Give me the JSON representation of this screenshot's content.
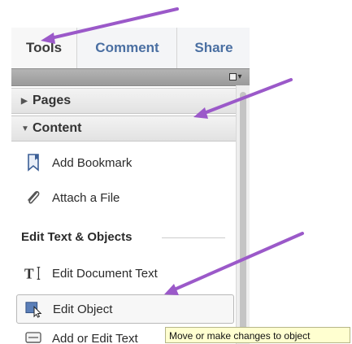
{
  "tabs": [
    {
      "label": "Tools"
    },
    {
      "label": "Comment"
    },
    {
      "label": "Share"
    }
  ],
  "sections": [
    {
      "label": "Pages",
      "state": "collapsed"
    },
    {
      "label": "Content",
      "state": "expanded"
    }
  ],
  "content_items": [
    {
      "label": "Add Bookmark",
      "icon": "bookmark-icon"
    },
    {
      "label": "Attach a File",
      "icon": "paperclip-icon"
    }
  ],
  "group": {
    "label": "Edit Text & Objects",
    "items": [
      {
        "label": "Edit Document Text",
        "icon": "text-cursor-icon"
      },
      {
        "label": "Edit Object",
        "icon": "edit-object-icon",
        "selected": true
      },
      {
        "label": "Add or Edit Text",
        "icon": "text-box-icon"
      }
    ]
  },
  "tooltip": {
    "text": "Move or make changes to object"
  },
  "colors": {
    "tab_accent": "#4a6fa2",
    "annotation_arrow": "#9b59c9",
    "tooltip_bg": "#ffffd0"
  }
}
